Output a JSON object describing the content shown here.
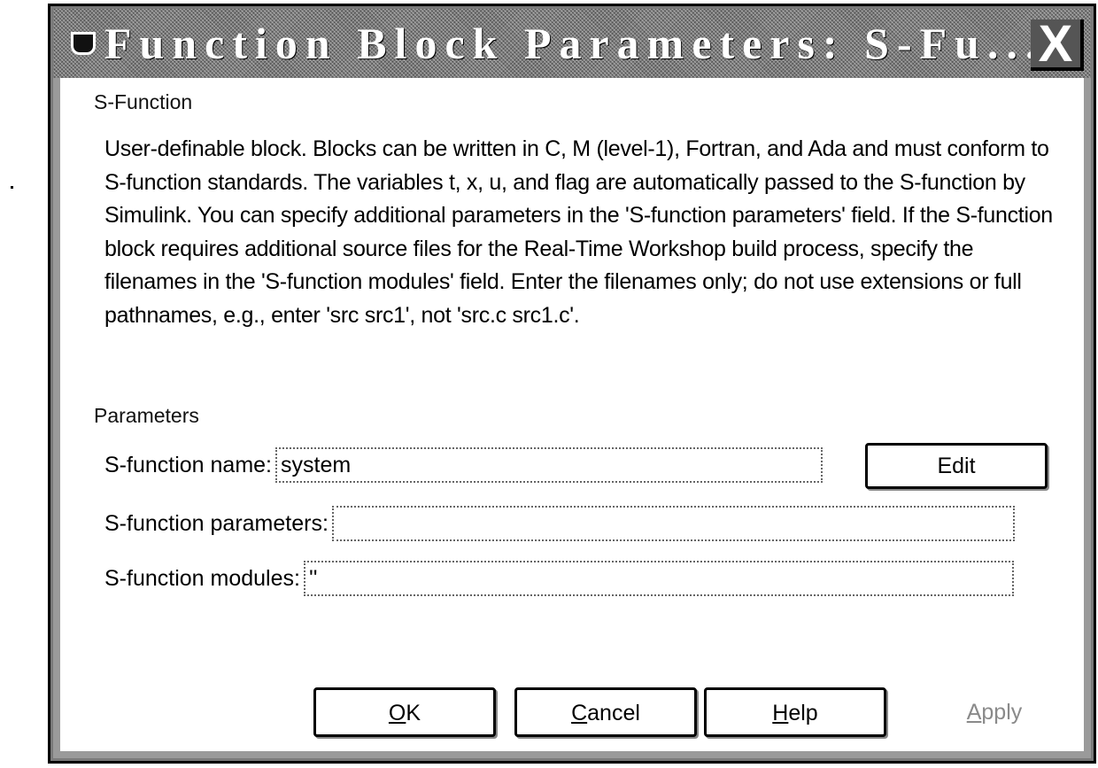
{
  "window": {
    "title": "Function Block Parameters: S-Fu...",
    "icon": "simulink-block-icon",
    "close_label": "X"
  },
  "sfunction_group": {
    "label": "S-Function",
    "description": "User-definable block.  Blocks can be written in C, M (level-1), Fortran, and Ada and must conform to S-function standards.  The variables t, x, u, and flag are automatically passed to the S-function by Simulink.  You can specify additional parameters in the 'S-function parameters' field. If the S-function block requires additional source files for the Real-Time Workshop build process, specify the filenames in the 'S-function modules' field. Enter the filenames only; do not use extensions or full pathnames, e.g., enter 'src src1', not 'src.c src1.c'."
  },
  "parameters_group": {
    "label": "Parameters",
    "fields": {
      "name": {
        "label": "S-function name:",
        "value": "system"
      },
      "parameters": {
        "label": "S-function parameters:",
        "value": ""
      },
      "modules": {
        "label": "S-function modules:",
        "value": "''"
      }
    },
    "edit_button": "Edit"
  },
  "buttons": {
    "ok": {
      "mnemonic": "O",
      "rest": "K"
    },
    "cancel": {
      "mnemonic": "C",
      "rest": "ancel"
    },
    "help": {
      "mnemonic": "H",
      "rest": "elp"
    },
    "apply": {
      "mnemonic": "A",
      "rest": "pply",
      "enabled": false
    }
  }
}
